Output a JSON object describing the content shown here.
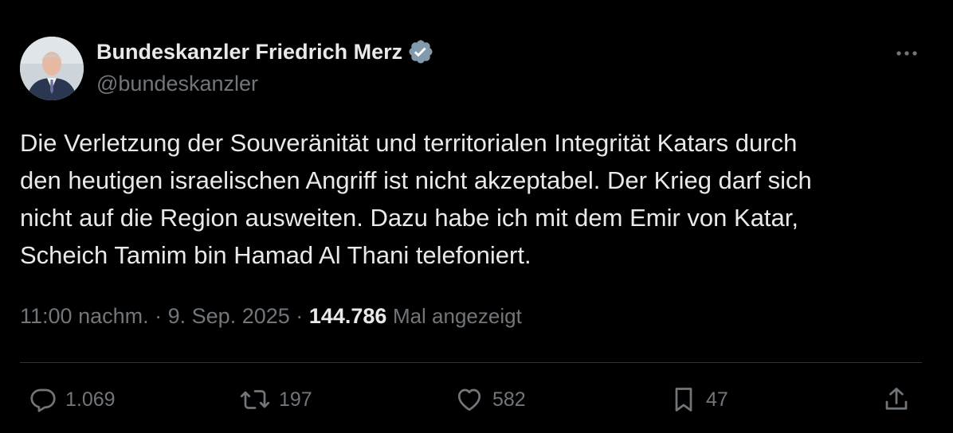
{
  "author": {
    "name": "Bundeskanzler Friedrich Merz",
    "handle": "@bundeskanzler",
    "verified_color": "#829aab"
  },
  "tweet": {
    "text": "Die Verletzung der Souveränität und territorialen Integrität Katars durch\nden heutigen israelischen Angriff ist nicht akzeptabel. Der Krieg darf sich\nnicht auf die Region ausweiten. Dazu habe ich mit dem Emir von Katar,\nScheich Tamim bin Hamad Al Thani telefoniert.",
    "time": "11:00 nachm.",
    "date": "9. Sep. 2025",
    "separator": "·",
    "views_count": "144.786",
    "views_label": "Mal angezeigt"
  },
  "actions": {
    "replies": "1.069",
    "retweets": "197",
    "likes": "582",
    "bookmarks": "47"
  },
  "icons": {
    "more": "more-icon",
    "reply": "reply-icon",
    "retweet": "retweet-icon",
    "like": "heart-icon",
    "bookmark": "bookmark-icon",
    "share": "share-icon",
    "verified": "verified-badge-icon"
  },
  "colors": {
    "background": "#000000",
    "primary_text": "#e7e9ea",
    "secondary_text": "#71767b",
    "divider": "#2f3336"
  }
}
